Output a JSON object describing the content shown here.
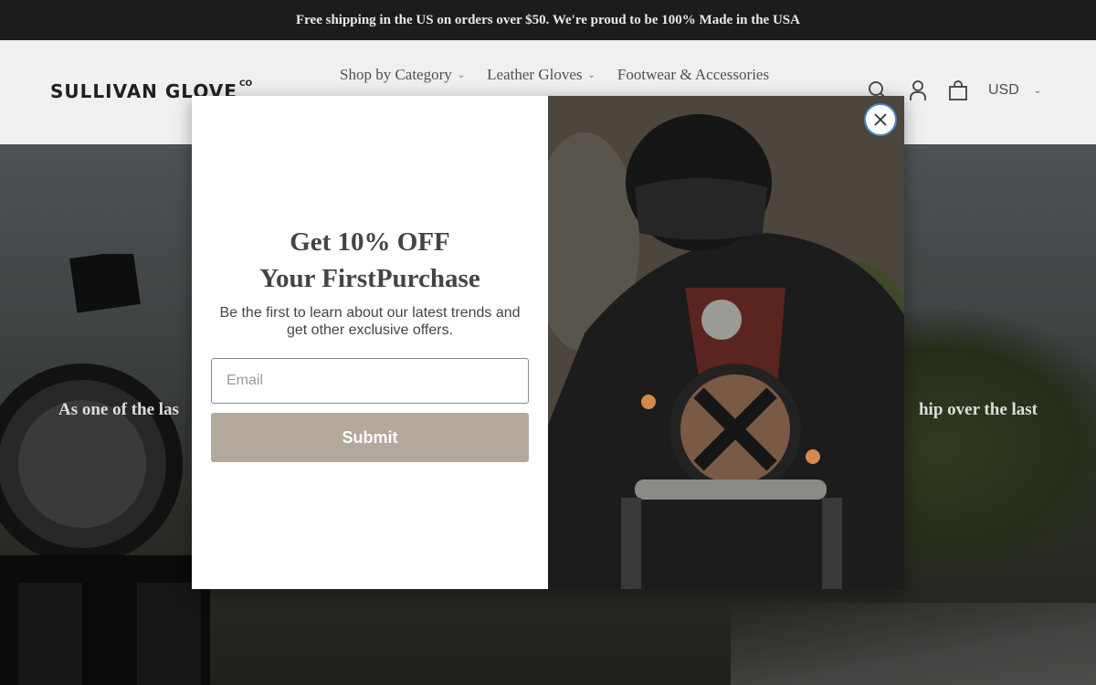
{
  "announcement": {
    "text": "Free shipping in the US on orders over $50. We're proud to be 100% Made in the USA"
  },
  "header": {
    "logo_text": "SULLIVAN GLOVE",
    "logo_suffix": "CO",
    "nav": [
      {
        "label": "Shop by Category",
        "has_dropdown": true
      },
      {
        "label": "Leather Gloves",
        "has_dropdown": true
      },
      {
        "label": "Footwear & Accessories",
        "has_dropdown": false
      }
    ],
    "icons": [
      "search-icon",
      "account-icon",
      "cart-icon"
    ],
    "currency": "USD"
  },
  "hero": {
    "text_left": "As one of the las",
    "text_right": "hip over the last"
  },
  "popup": {
    "title_line1": "Get 10% OFF",
    "title_line2": "Your FirstPurchase",
    "subtitle": "Be the first to learn about our latest trends and get other exclusive offers.",
    "email_placeholder": "Email",
    "submit_label": "Submit",
    "close_icon": "close-icon"
  },
  "colors": {
    "announcement_bg": "#1c1c1c",
    "submit_bg": "#b2a89c",
    "close_ring": "#4b86c4"
  }
}
